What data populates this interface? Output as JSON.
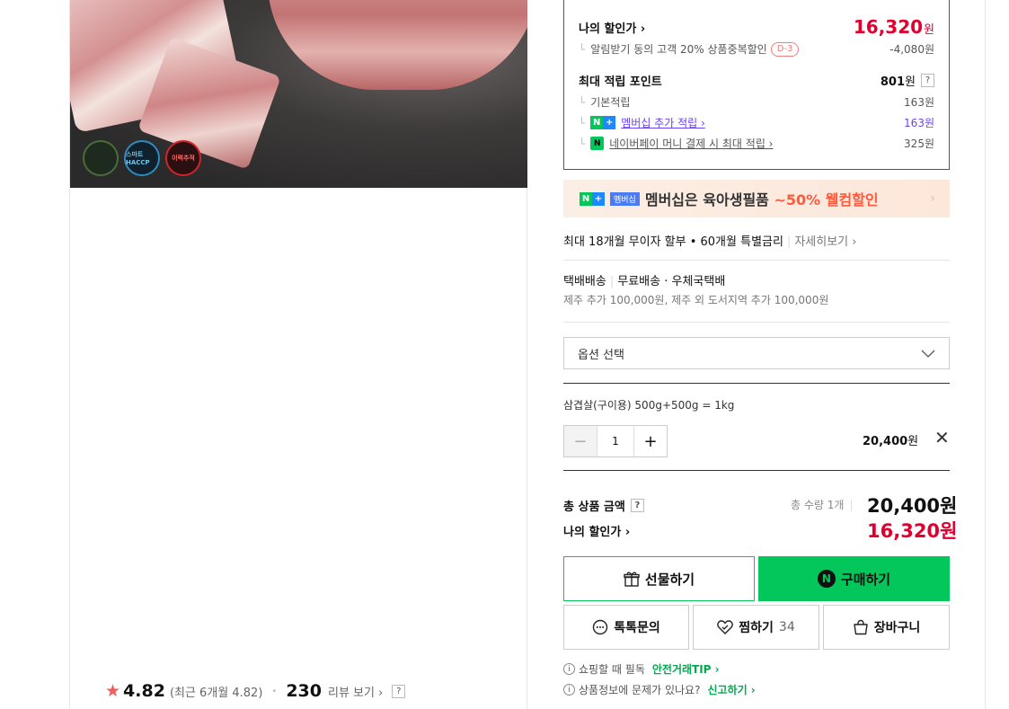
{
  "product": {
    "badges": [
      "",
      "스마트 HACCP",
      "이력추적"
    ],
    "rating": {
      "score": "4.82",
      "recent": "(최근 6개월 4.82)",
      "review_count": "230",
      "review_link": "리뷰 보기 ›",
      "help": "?"
    }
  },
  "discount": {
    "my_price_label": "나의 할인가 ›",
    "my_price": "16,320",
    "won": "원",
    "coupon_label": "알림받기 동의 고객 20% 상품중복할인",
    "coupon_tag": "D-3",
    "coupon_value": "-4,080원",
    "points_label": "최대 적립 포인트",
    "points_value": "801",
    "points_help": "?",
    "basic_label": "기본적립",
    "basic_value": "163원",
    "member_label": "멤버십 추가 적립 ›",
    "member_value": "163원",
    "npay_label": "네이버페이 머니 결제 시 최대 적립 ›",
    "npay_value": "325원",
    "npay_mark": "N"
  },
  "banner": {
    "n": "N",
    "plus": "+",
    "membership_tag": "멤버십",
    "text": "멤버십은 육아생필품 ",
    "highlight": "~50% 웰컴할인",
    "arrow": "›"
  },
  "installment": {
    "text": "최대 18개월 무이자 할부 • 60개월 특별금리",
    "link": "자세히보기 ›"
  },
  "delivery": {
    "method": "택배배송",
    "fee": "무료배송",
    "carrier": "· 우체국택배",
    "extra": "제주 추가 100,000원, 제주 외 도서지역 추가 100,000원"
  },
  "option": {
    "placeholder": "옵션 선택",
    "selected_name": "삼겹살(구이용) 500g+500g = 1kg",
    "quantity": "1",
    "price": "20,400",
    "won": "원"
  },
  "totals": {
    "label": "총 상품 금액",
    "help": "?",
    "qty": "총 수량 1개",
    "price": "20,400원",
    "my_discount_label": "나의 할인가 ›",
    "my_discount_price": "16,320원"
  },
  "buttons": {
    "gift": "선물하기",
    "buy": "구매하기",
    "talk": "톡톡문의",
    "wish": "찜하기",
    "wish_count": "34",
    "cart": "장바구니"
  },
  "info": {
    "line1": "쇼핑할 때 필독",
    "line1_link": "안전거래TIP ›",
    "line2": "상품정보에 문제가 있나요?",
    "line2_link": "신고하기 ›"
  },
  "colors": {
    "brand_green": "#03c75a",
    "price_red": "#e1002d",
    "member_purple": "#6b42f5"
  }
}
